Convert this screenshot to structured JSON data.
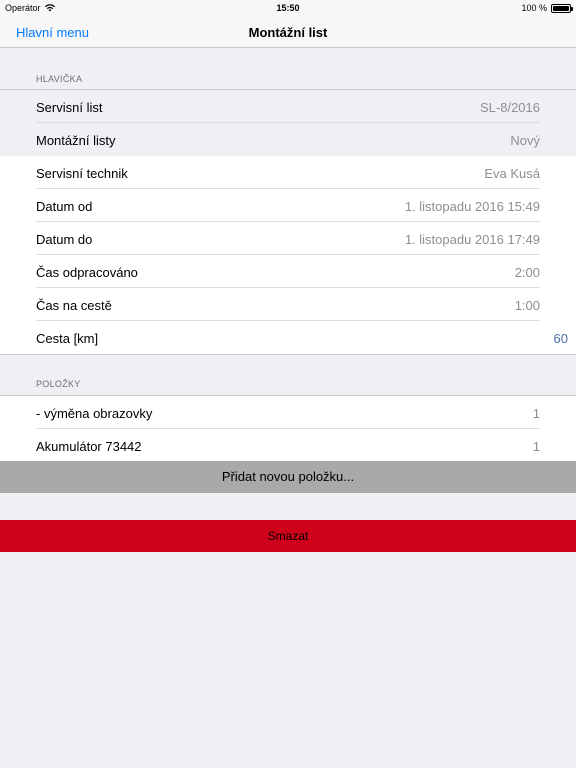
{
  "status_bar": {
    "carrier": "Operátor",
    "time": "15:50",
    "battery_percent": "100 %",
    "battery_level": 1.0
  },
  "nav": {
    "back_label": "Hlavní menu",
    "title": "Montážní list"
  },
  "header_section": {
    "title": "HLAVIČKA",
    "rows": [
      {
        "label": "Servisní list",
        "value": "SL-8/2016"
      },
      {
        "label": "Montážní listy",
        "value": "Nový"
      },
      {
        "label": "Servisní technik",
        "value": "Eva Kusá"
      },
      {
        "label": "Datum od",
        "value": "1. listopadu 2016 15:49"
      },
      {
        "label": "Datum do",
        "value": "1. listopadu 2016 17:49"
      },
      {
        "label": "Čas odpracováno",
        "value": "2:00"
      },
      {
        "label": "Čas na cestě",
        "value": "1:00"
      },
      {
        "label": "Cesta [km]",
        "value": "60"
      }
    ]
  },
  "items_section": {
    "title": "POLOŽKY",
    "rows": [
      {
        "label": "- výměna obrazovky",
        "value": "1"
      },
      {
        "label": "Akumulátor 73442",
        "value": "1"
      }
    ],
    "add_label": "Přidat novou položku..."
  },
  "delete_label": "Smazat",
  "colors": {
    "accent": "#007aff",
    "delete": "#d0021b",
    "add_button": "#a9a9a9",
    "km_value": "#4a6fa5"
  }
}
